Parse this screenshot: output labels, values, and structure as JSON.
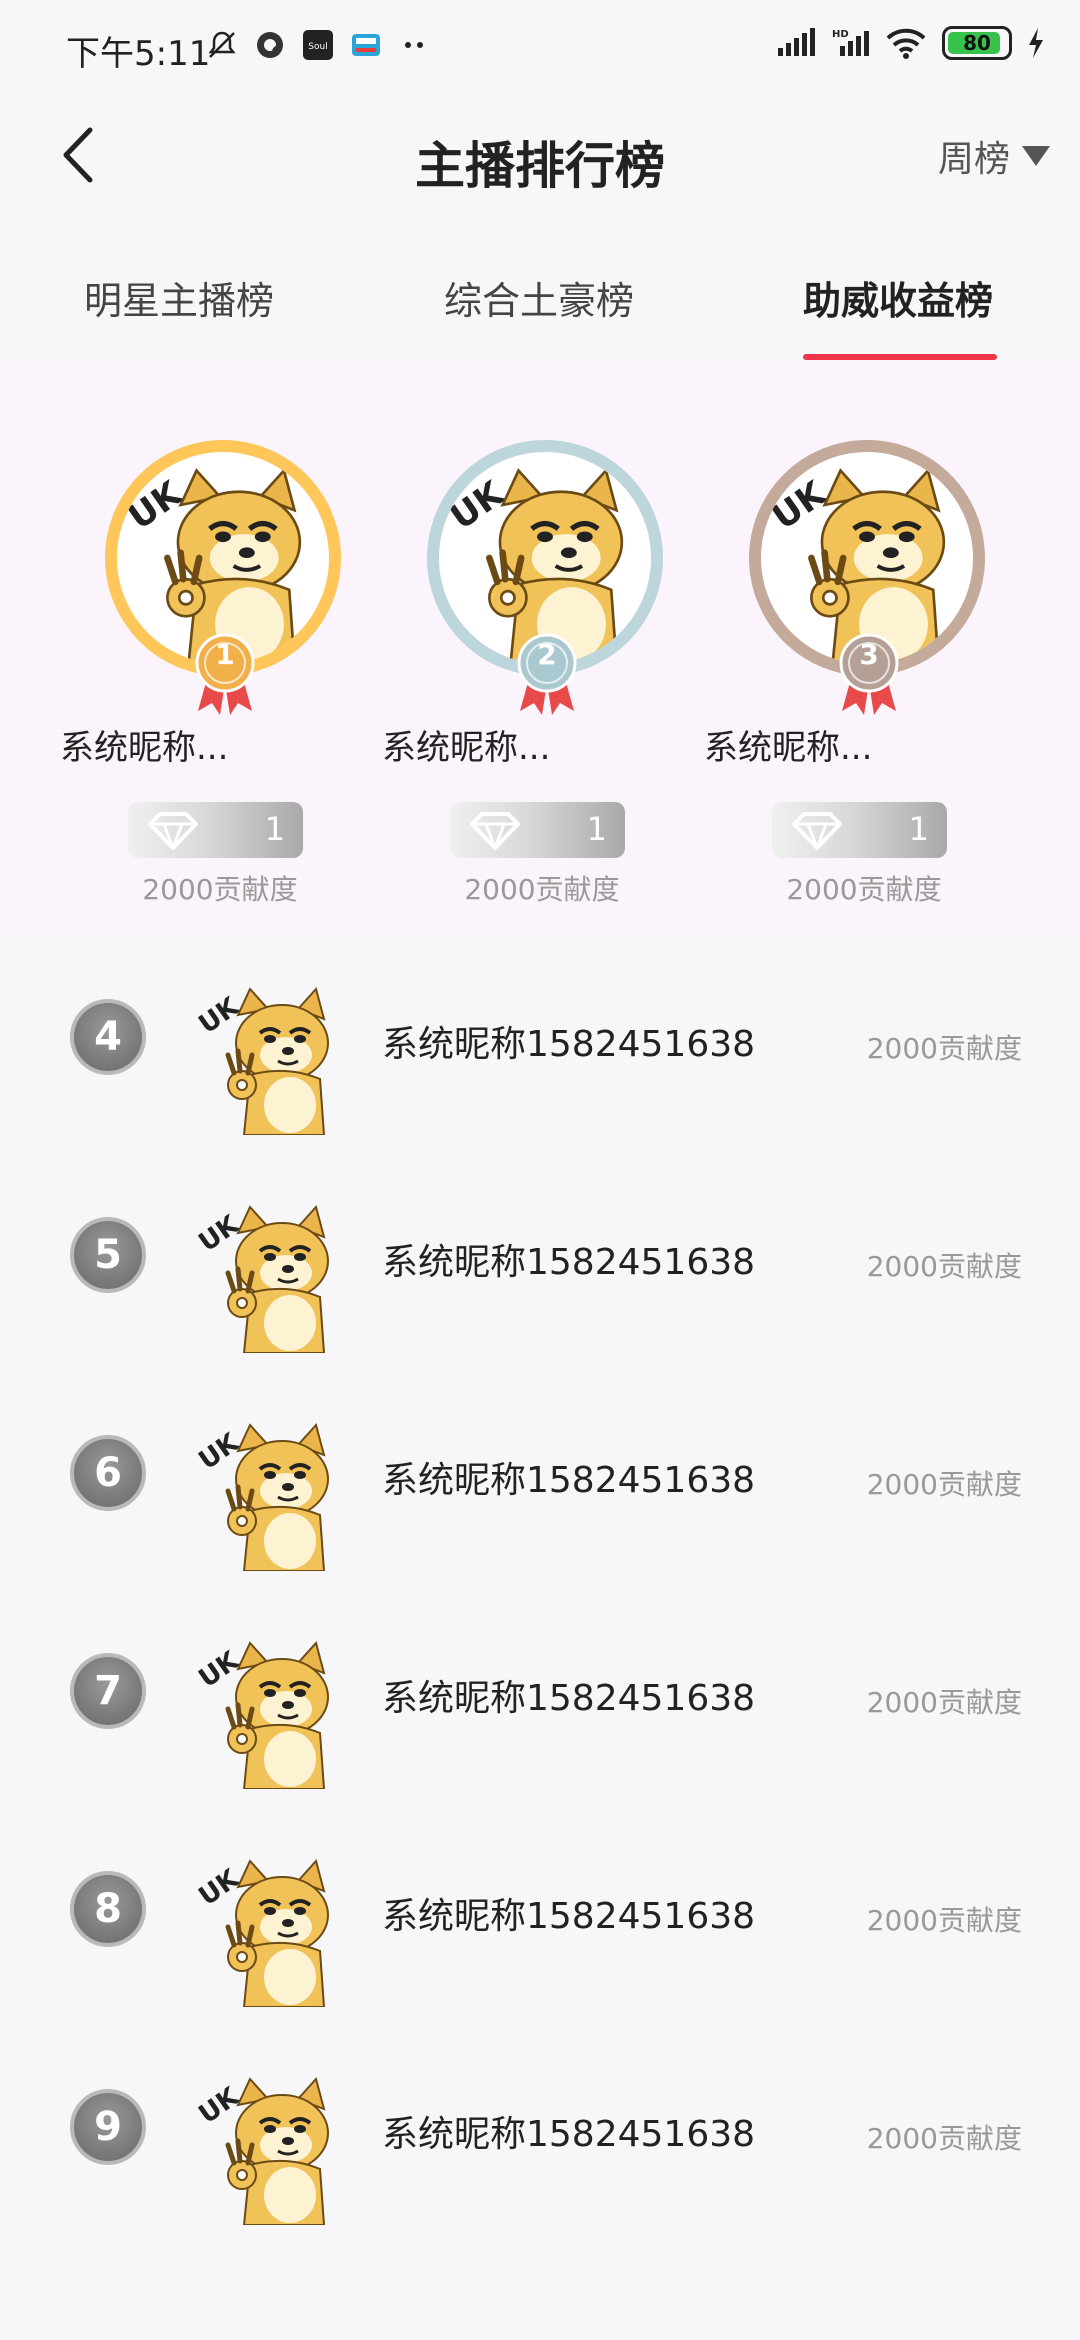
{
  "status_bar": {
    "time": "下午5:11",
    "battery": "80",
    "icons": [
      "mute-bell-icon",
      "q-app-icon",
      "soul-app-icon",
      "news-app-icon",
      "more-dots-icon",
      "signal-icon",
      "hd-signal-icon",
      "wifi-icon",
      "battery-icon",
      "charging-icon"
    ]
  },
  "header": {
    "title": "主播排行榜",
    "period_label": "周榜"
  },
  "tabs": [
    {
      "label": "明星主播榜",
      "active": false
    },
    {
      "label": "综合土豪榜",
      "active": false
    },
    {
      "label": "助威收益榜",
      "active": true
    }
  ],
  "podium": [
    {
      "rank": "1",
      "name": "系统昵称...",
      "count": "1",
      "score": "2000贡献度",
      "ring_color": "#ffc65a",
      "medal_color": "#f2b04a"
    },
    {
      "rank": "2",
      "name": "系统昵称...",
      "count": "1",
      "score": "2000贡献度",
      "ring_color": "#bcd6dc",
      "medal_color": "#a9c8cf"
    },
    {
      "rank": "3",
      "name": "系统昵称...",
      "count": "1",
      "score": "2000贡献度",
      "ring_color": "#c4aa9a",
      "medal_color": "#b5a096"
    }
  ],
  "list": [
    {
      "rank": "4",
      "name": "系统昵称1582451638",
      "score": "2000贡献度"
    },
    {
      "rank": "5",
      "name": "系统昵称1582451638",
      "score": "2000贡献度"
    },
    {
      "rank": "6",
      "name": "系统昵称1582451638",
      "score": "2000贡献度"
    },
    {
      "rank": "7",
      "name": "系统昵称1582451638",
      "score": "2000贡献度"
    },
    {
      "rank": "8",
      "name": "系统昵称1582451638",
      "score": "2000贡献度"
    },
    {
      "rank": "9",
      "name": "系统昵称1582451638",
      "score": "2000贡献度"
    }
  ],
  "colors": {
    "accent": "#f0344a",
    "podium_bg": "#fcf4fc"
  }
}
